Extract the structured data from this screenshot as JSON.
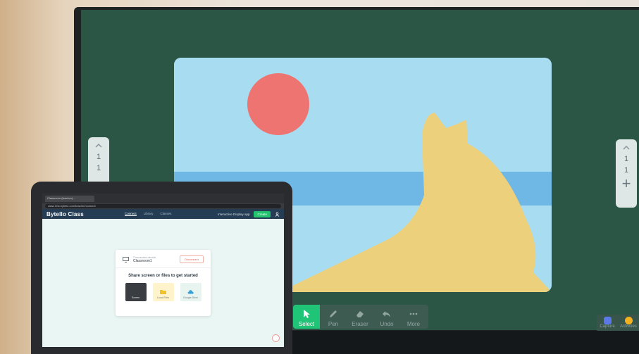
{
  "board": {
    "pager_left": {
      "page_a": "1",
      "page_b": "1"
    },
    "pager_right": {
      "page_a": "1",
      "page_b": "1",
      "add_label": "+"
    },
    "toolbar": {
      "select": "Select",
      "pen": "Pen",
      "eraser": "Eraser",
      "undo": "Undo",
      "more": "More"
    },
    "side_tools": {
      "capture": "Capture",
      "activities": "Activities"
    },
    "colors": {
      "canvas": "#a8dcf0",
      "sun": "#ee7472",
      "sea": "#6fb8e6",
      "sand": "#ecd07c",
      "active_tool": "#1fc476"
    }
  },
  "laptop": {
    "browser": {
      "tab_title": "Classroom (teacher)…",
      "url": "class.test.bytello.com/teacher/connect"
    },
    "app": {
      "brand": "Bytello Class",
      "nav": [
        "Connect",
        "Library",
        "Classes"
      ],
      "download_link": "Interactive Display app",
      "create_button": "Create"
    },
    "card": {
      "device_label": "Connected device",
      "device_name": "Classroom1",
      "disconnect_button": "Disconnect",
      "title": "Share screen or files to get started",
      "options": [
        "Screen",
        "Local Files",
        "Google Drive"
      ]
    }
  }
}
